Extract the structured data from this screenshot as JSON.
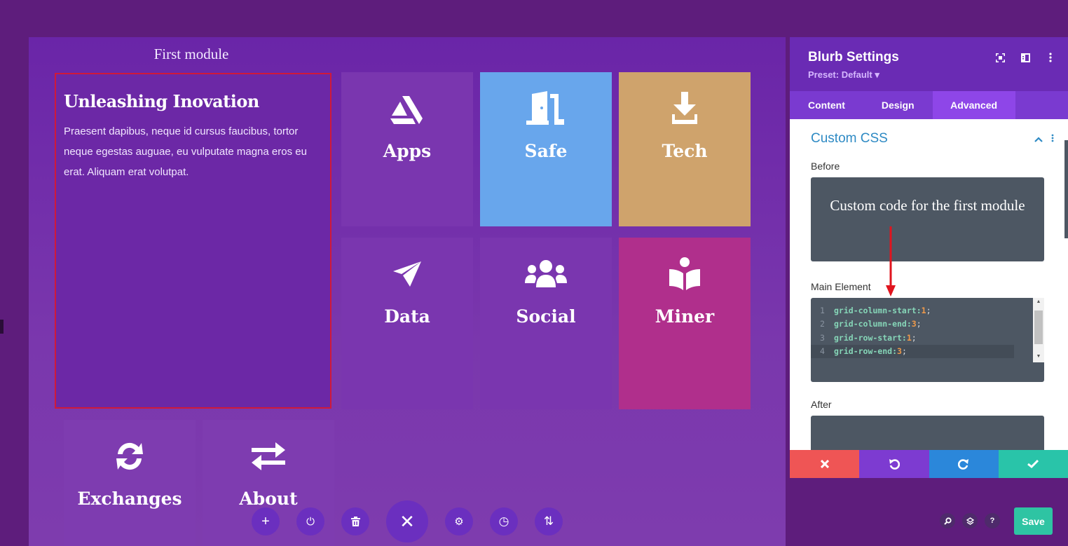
{
  "canvas": {
    "section_title": "First module",
    "featured": {
      "title": "Unleashing Inovation",
      "body": "Praesent dapibus, neque id cursus faucibus, tortor neque egestas auguae, eu vulputate magna eros eu erat. Aliquam erat volutpat.",
      "highlight_color": "#d0193a"
    },
    "tiles": [
      {
        "label": "Apps",
        "icon": "artstation-icon",
        "color": "#7a36af"
      },
      {
        "label": "Safe",
        "icon": "door-open-icon",
        "color": "#68a6ec"
      },
      {
        "label": "Tech",
        "icon": "download-icon",
        "color": "#cfa36c"
      },
      {
        "label": "Data",
        "icon": "paper-plane-icon",
        "color": "#7a36af"
      },
      {
        "label": "Social",
        "icon": "users-icon",
        "color": "#7a36af"
      },
      {
        "label": "Miner",
        "icon": "book-reader-icon",
        "color": "#b02f8c"
      },
      {
        "label": "Exchanges",
        "icon": "sync-icon",
        "color": "#7e3cb0"
      },
      {
        "label": "About",
        "icon": "exchange-arrows-icon",
        "color": "#7e3cb0"
      }
    ],
    "toolbar": [
      {
        "name": "add",
        "glyph": "+"
      },
      {
        "name": "power",
        "glyph": "⏻"
      },
      {
        "name": "trash",
        "glyph": "🗑"
      },
      {
        "name": "close",
        "glyph": "✕"
      },
      {
        "name": "settings",
        "glyph": "⚙"
      },
      {
        "name": "history",
        "glyph": "◷"
      },
      {
        "name": "sort",
        "glyph": "⇅"
      }
    ]
  },
  "panel": {
    "title": "Blurb Settings",
    "preset": "Preset: Default ▾",
    "tabs": [
      {
        "label": "Content",
        "active": false
      },
      {
        "label": "Design",
        "active": false
      },
      {
        "label": "Advanced",
        "active": true
      }
    ],
    "section_title": "Custom CSS",
    "fields": {
      "before": {
        "label": "Before",
        "overlay_text": "Custom code for the first module"
      },
      "main_element": {
        "label": "Main Element",
        "lines": [
          {
            "n": "1",
            "prop": "grid-column-start:",
            "val": "1",
            "end": ";"
          },
          {
            "n": "2",
            "prop": "grid-column-end:",
            "val": "3",
            "end": ";"
          },
          {
            "n": "3",
            "prop": "grid-row-start:",
            "val": "1",
            "end": ";"
          },
          {
            "n": "4",
            "prop": "grid-row-end:",
            "val": "3",
            "end": ";"
          }
        ]
      },
      "after": {
        "label": "After"
      }
    },
    "actions": [
      {
        "name": "discard",
        "color": "#ef5555"
      },
      {
        "name": "undo",
        "color": "#7d3bd1"
      },
      {
        "name": "redo",
        "color": "#2b87da"
      },
      {
        "name": "confirm",
        "color": "#29c4a9"
      }
    ]
  },
  "footer": {
    "save_label": "Save",
    "help_glyph": "?"
  }
}
